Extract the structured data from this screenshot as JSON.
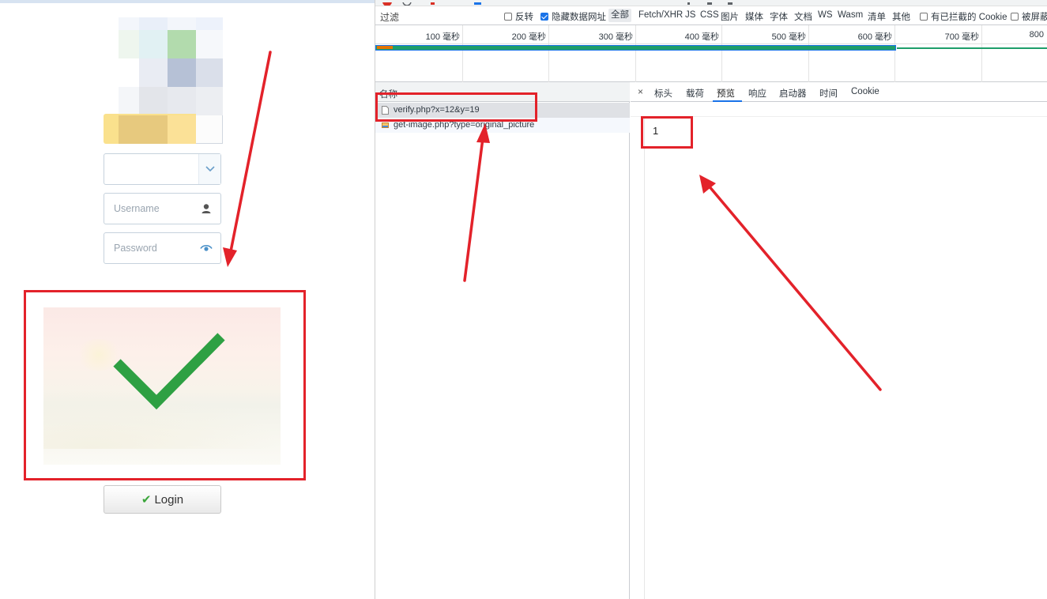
{
  "login": {
    "username_placeholder": "Username",
    "password_placeholder": "Password",
    "login_label": "Login",
    "login_check": "✔"
  },
  "devtools": {
    "filter_placeholder": "过滤",
    "filter_options": [
      {
        "label": "反转",
        "checked": false
      },
      {
        "label": "隐藏数据网址",
        "checked": true
      }
    ],
    "type_filters": [
      "全部",
      "Fetch/XHR",
      "JS",
      "CSS",
      "图片",
      "媒体",
      "字体",
      "文档",
      "WS",
      "Wasm",
      "清单",
      "其他"
    ],
    "extra_options": [
      {
        "label": "有已拦截的 Cookie",
        "checked": false
      },
      {
        "label": "被屏蔽",
        "checked": false
      }
    ],
    "timeline_ticks": [
      "100 毫秒",
      "200 毫秒",
      "300 毫秒",
      "400 毫秒",
      "500 毫秒",
      "600 毫秒",
      "700 毫秒",
      "800"
    ],
    "name_header": "名称",
    "requests": [
      {
        "name": "verify.php?x=12&y=19",
        "icon": "document-icon"
      },
      {
        "name": "get-image.php?type=original_picture",
        "icon": "image-icon"
      }
    ],
    "detail_tabs": [
      "标头",
      "载荷",
      "预览",
      "响应",
      "启动器",
      "时间",
      "Cookie"
    ],
    "active_tab": "预览",
    "close_symbol": "×",
    "preview_value": "1"
  },
  "colors": {
    "annotation_red": "#e3222a",
    "check_green": "#2ea043",
    "devtools_blue": "#1a73e8"
  }
}
